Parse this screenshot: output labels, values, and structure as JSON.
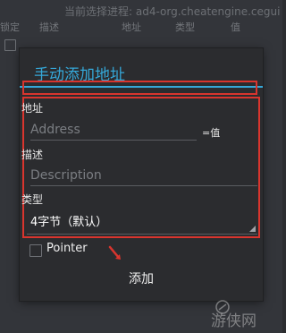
{
  "background_app": {
    "title": "当前选择进程: ad4-org.cheatengine.cegui",
    "headers": {
      "lock": "锁定",
      "description": "描述",
      "address": "地址",
      "type": "类型",
      "value": "值"
    }
  },
  "dialog": {
    "title": "手动添加地址",
    "address_label": "地址",
    "address_placeholder": "Address",
    "value_suffix": "=值",
    "description_label": "描述",
    "description_placeholder": "Description",
    "type_label": "类型",
    "type_selected": "4字节（默认）",
    "pointer_label": "Pointer",
    "add_button": "添加"
  },
  "annotation_color": "#d9352e",
  "accent_color": "#35a8d9",
  "watermark": {
    "text": "游侠网"
  }
}
